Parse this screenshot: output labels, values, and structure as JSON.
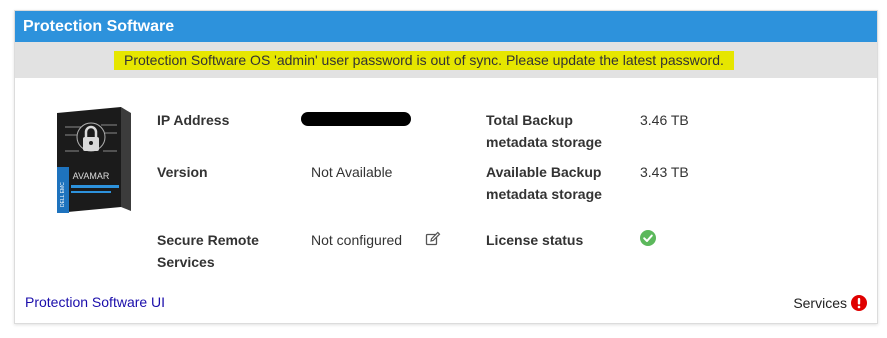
{
  "header": {
    "title": "Protection Software"
  },
  "banner": {
    "message": "Protection Software OS 'admin' user password is out of sync. Please update the latest password."
  },
  "product": {
    "name": "AVAMAR",
    "vendor": "DELL EMC",
    "icon": "avamar-product-box"
  },
  "fields": {
    "ip_address_label": "IP Address",
    "ip_address_value": "",
    "version_label": "Version",
    "version_value": "Not Available",
    "remote_label_line1": "Secure Remote",
    "remote_label_line2": "Services",
    "remote_value": "Not configured",
    "total_label_line1": "Total Backup",
    "total_label_line2": "metadata storage",
    "total_value": "3.46 TB",
    "available_label_line1": "Available Backup",
    "available_label_line2": "metadata storage",
    "available_value": "3.43 TB",
    "license_label": "License status"
  },
  "footer": {
    "ui_link": "Protection Software UI",
    "services_label": "Services"
  },
  "icons": {
    "edit": "edit-icon",
    "license_ok": "check-circle-icon",
    "services_alert": "alert-icon"
  },
  "colors": {
    "header": "#2d92dc",
    "banner_bg": "#e2e2e2",
    "highlight": "#e6e600",
    "ok": "#5cb85c",
    "alert": "#e00000",
    "link": "#1a0dab"
  }
}
